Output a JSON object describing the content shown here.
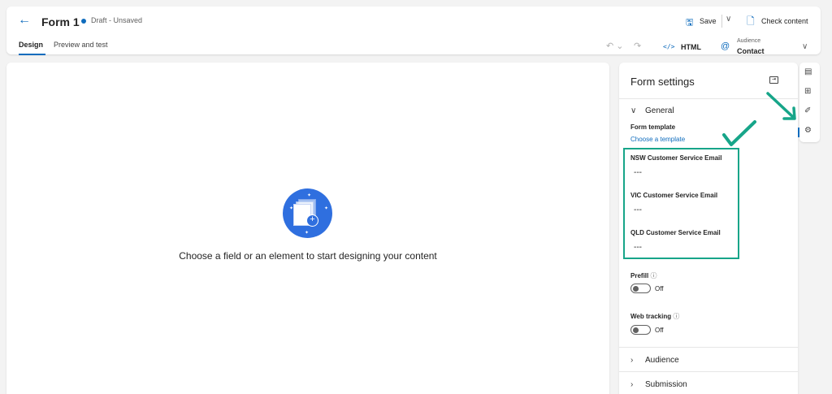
{
  "header": {
    "title": "Form 1",
    "status": "Draft - Unsaved",
    "save_label": "Save",
    "check_label": "Check content",
    "tabs": [
      "Design",
      "Preview and test"
    ],
    "html_label": "HTML",
    "audience_caption": "Audience",
    "audience_value": "Contact"
  },
  "canvas": {
    "empty_message": "Choose a field or an element to start designing your content"
  },
  "panel": {
    "title": "Form settings",
    "general_label": "General",
    "form_template_label": "Form template",
    "template_link": "Choose a template",
    "emails": [
      {
        "label": "NSW Customer Service Email",
        "value": "---"
      },
      {
        "label": "VIC Customer Service Email",
        "value": "---"
      },
      {
        "label": "QLD Customer Service Email",
        "value": "---"
      }
    ],
    "prefill_label": "Prefill",
    "prefill_state": "Off",
    "web_tracking_label": "Web tracking",
    "web_tracking_state": "Off",
    "audience_section": "Audience",
    "submission_section": "Submission"
  },
  "icons": {
    "back": "arrow-left-icon",
    "save": "save-icon",
    "check": "document-check-icon",
    "undo": "undo-icon",
    "redo": "redo-icon",
    "html": "code-icon",
    "audience": "contact-icon",
    "collapse": "panel-collapse-icon",
    "rail": [
      "form-settings-icon",
      "add-element-icon",
      "theme-icon",
      "settings-wand-icon"
    ]
  },
  "colors": {
    "accent": "#0f6cbd",
    "annotation": "#17a589",
    "illustration": "#2f6fdf"
  }
}
